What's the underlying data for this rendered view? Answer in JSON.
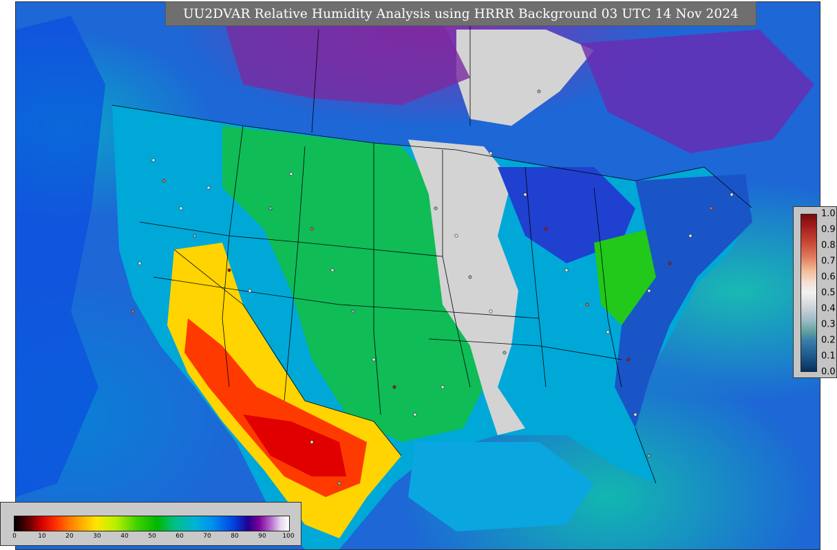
{
  "title": "UU2DVAR Relative Humidity Analysis using HRRR Background 03 UTC 14 Nov 2024",
  "rh_colorbar": {
    "ticks": [
      "0",
      "10",
      "20",
      "30",
      "40",
      "50",
      "60",
      "70",
      "80",
      "90",
      "100"
    ],
    "colors": [
      "#000000",
      "#d60000",
      "#ff7a00",
      "#ffe600",
      "#3ad000",
      "#00b800",
      "#00b2d8",
      "#0090f0",
      "#0040e0",
      "#7a0099",
      "#ffffff"
    ]
  },
  "diff_colorbar": {
    "ticks": [
      "1.0",
      "0.9",
      "0.8",
      "0.7",
      "0.6",
      "0.5",
      "0.4",
      "0.3",
      "0.2",
      "0.1",
      "0.0"
    ]
  },
  "map": {
    "ocean_color": "#1d67d6",
    "dry_color": "#ff2000",
    "moist_color": "#00b800",
    "saturated_color": "#d3d3d3",
    "observation_marker": "circle"
  }
}
